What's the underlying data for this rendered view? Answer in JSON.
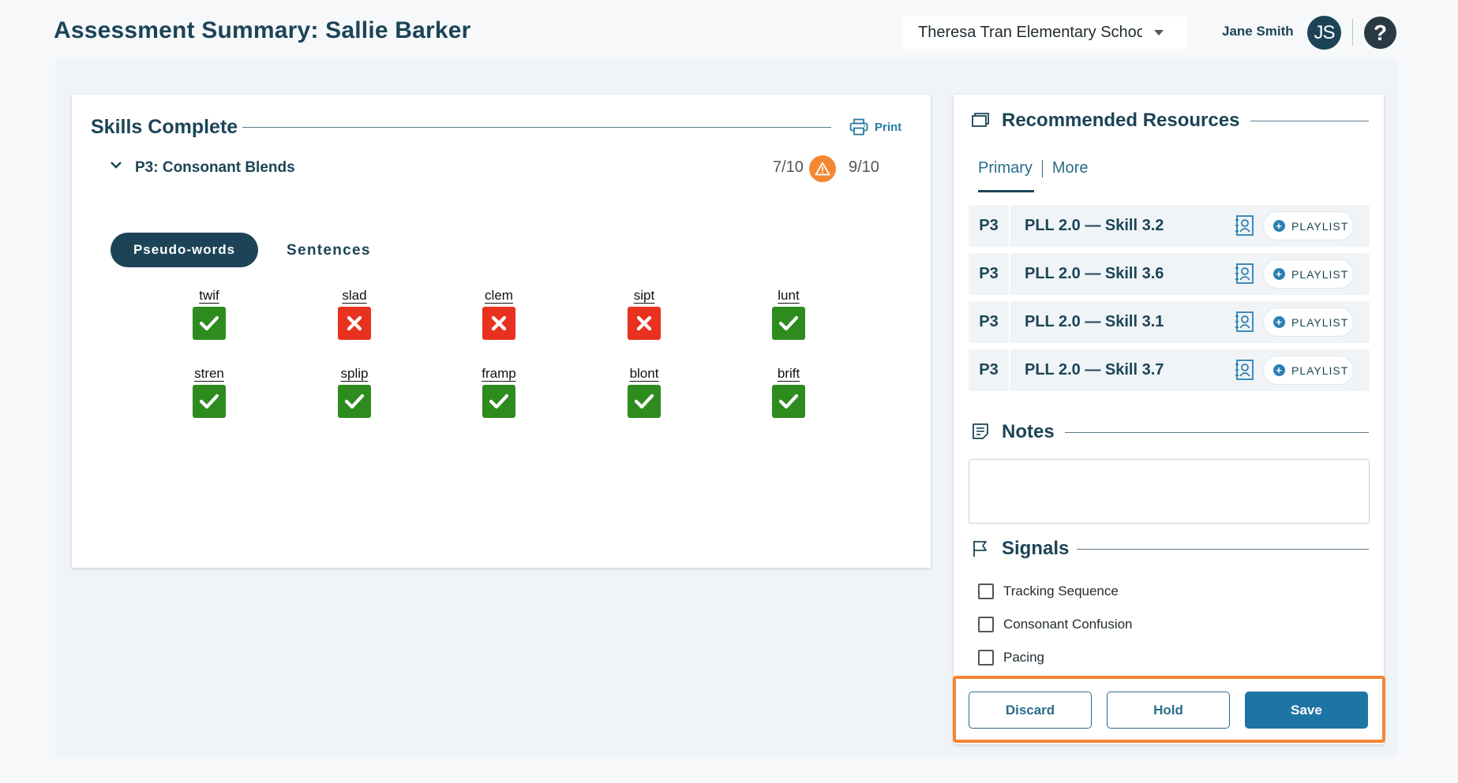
{
  "header": {
    "title": "Assessment Summary: Sallie Barker",
    "school_select": "Theresa Tran Elementary School",
    "user_name": "Jane Smith",
    "user_initials": "JS",
    "help_symbol": "?"
  },
  "skills": {
    "title": "Skills Complete",
    "print_label": "Print",
    "section_label": "P3: Consonant Blends",
    "score_first": "7/10",
    "score_second": "9/10",
    "tabs": [
      "Pseudo-words",
      "Sentences"
    ],
    "words": [
      {
        "word": "twif",
        "result": "correct"
      },
      {
        "word": "slad",
        "result": "incorrect"
      },
      {
        "word": "clem",
        "result": "incorrect"
      },
      {
        "word": "sipt",
        "result": "incorrect"
      },
      {
        "word": "lunt",
        "result": "correct"
      },
      {
        "word": "stren",
        "result": "correct"
      },
      {
        "word": "splip",
        "result": "correct"
      },
      {
        "word": "framp",
        "result": "correct"
      },
      {
        "word": "blont",
        "result": "correct"
      },
      {
        "word": "brift",
        "result": "correct"
      }
    ]
  },
  "resources": {
    "title": "Recommended Resources",
    "tabs": [
      "Primary",
      "More"
    ],
    "items": [
      {
        "level": "P3",
        "name": "PLL 2.0 — Skill 3.2",
        "action": "PLAYLIST"
      },
      {
        "level": "P3",
        "name": "PLL 2.0 — Skill 3.6",
        "action": "PLAYLIST"
      },
      {
        "level": "P3",
        "name": "PLL 2.0 — Skill 3.1",
        "action": "PLAYLIST"
      },
      {
        "level": "P3",
        "name": "PLL 2.0 — Skill 3.7",
        "action": "PLAYLIST"
      }
    ]
  },
  "notes": {
    "title": "Notes",
    "value": ""
  },
  "signals": {
    "title": "Signals",
    "items": [
      {
        "label": "Tracking Sequence",
        "checked": false
      },
      {
        "label": "Consonant Confusion",
        "checked": false
      },
      {
        "label": "Pacing",
        "checked": false
      }
    ]
  },
  "actions": {
    "discard": "Discard",
    "hold": "Hold",
    "save": "Save"
  },
  "colors": {
    "brand_dark": "#1c4456",
    "correct": "#2e8b1e",
    "incorrect": "#e8321f",
    "warning": "#f58634",
    "primary_button": "#1f74a6"
  }
}
